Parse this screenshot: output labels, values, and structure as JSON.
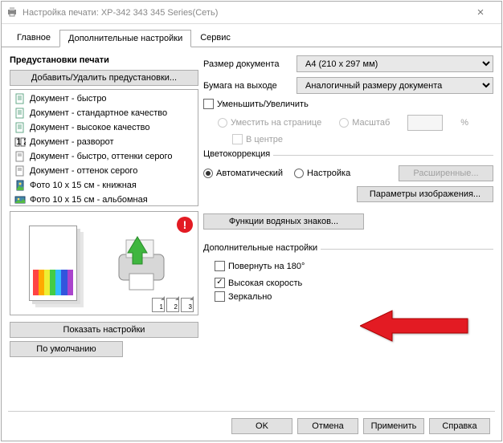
{
  "titlebar": {
    "title": "Настройка печати: XP-342 343 345 Series(Сеть)"
  },
  "tabs": {
    "main": "Главное",
    "advanced": "Дополнительные настройки",
    "service": "Сервис"
  },
  "left": {
    "presets_title": "Предустановки печати",
    "manage_btn": "Добавить/Удалить предустановки...",
    "items": [
      "Документ - быстро",
      "Документ - стандартное качество",
      "Документ - высокое качество",
      "Документ - разворот",
      "Документ - быстро, оттенки серого",
      "Документ - оттенок серого",
      "Фото 10 x 15 см - книжная",
      "Фото 10 x 15 см - альбомная"
    ],
    "show_settings": "Показать настройки",
    "defaults": "По умолчанию"
  },
  "right": {
    "doc_size_label": "Размер документа",
    "doc_size_value": "A4 (210 x 297 мм)",
    "output_label": "Бумага на выходе",
    "output_value": "Аналогичный размеру документа",
    "reduce_enlarge": "Уменьшить/Увеличить",
    "fit_page": "Уместить на странице",
    "scale": "Масштаб",
    "percent": "%",
    "center": "В центре",
    "color_group": "Цветокоррекция",
    "auto": "Автоматический",
    "tune": "Настройка",
    "advanced_btn": "Расширенные...",
    "image_params": "Параметры изображения...",
    "watermark": "Функции водяных знаков...",
    "add_group": "Дополнительные настройки",
    "rotate": "Повернуть на 180°",
    "highspeed": "Высокая скорость",
    "mirror": "Зеркально"
  },
  "footer": {
    "ok": "OK",
    "cancel": "Отмена",
    "apply": "Применить",
    "help": "Справка"
  }
}
